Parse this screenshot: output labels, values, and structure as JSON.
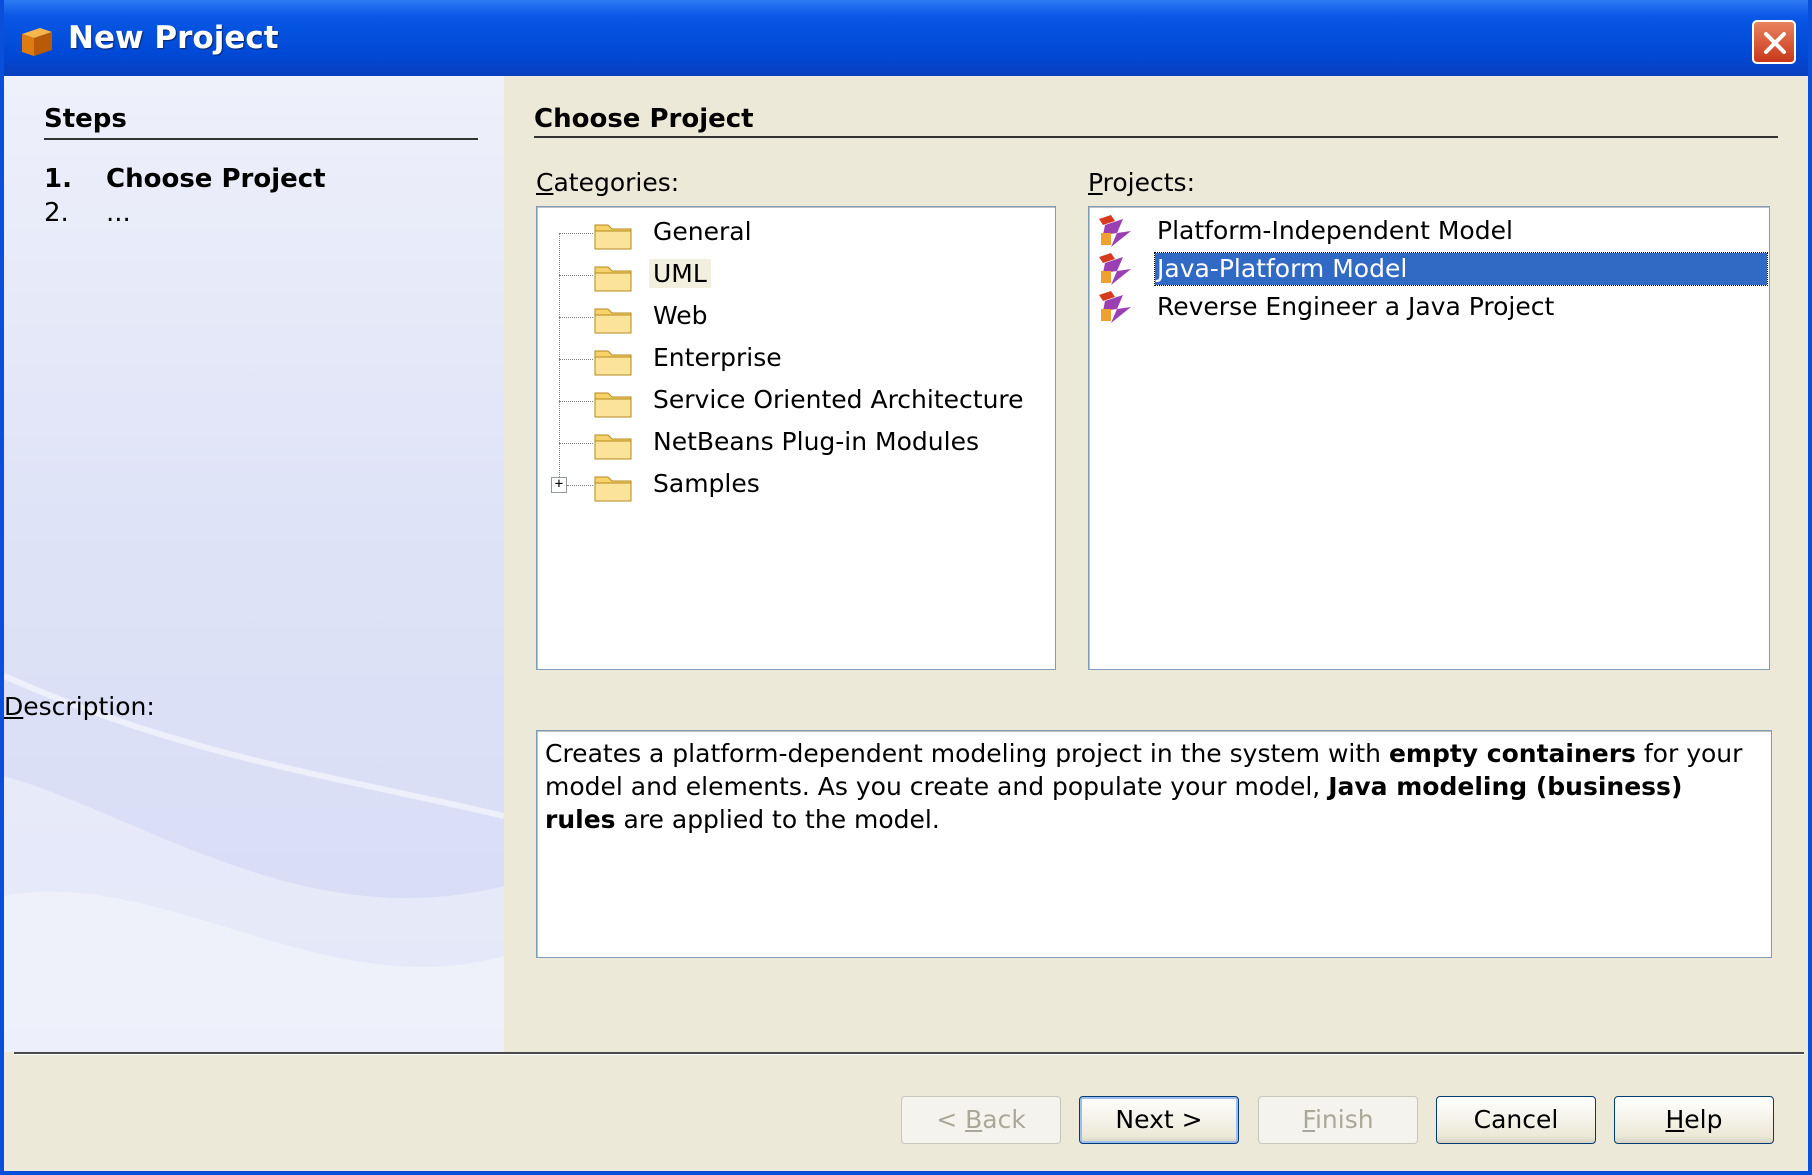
{
  "window": {
    "title": "New Project"
  },
  "steps": {
    "heading": "Steps",
    "items": [
      {
        "number": "1.",
        "label": "Choose Project",
        "current": true
      },
      {
        "number": "2.",
        "label": "...",
        "current": false
      }
    ]
  },
  "main": {
    "heading": "Choose Project",
    "categories": {
      "label_pre": "",
      "label_key": "C",
      "label_post": "ategories:",
      "items": [
        {
          "label": "General",
          "selected": false
        },
        {
          "label": "UML",
          "selected": true
        },
        {
          "label": "Web",
          "selected": false
        },
        {
          "label": "Enterprise",
          "selected": false
        },
        {
          "label": "Service Oriented Architecture",
          "selected": false
        },
        {
          "label": "NetBeans Plug-in Modules",
          "selected": false
        },
        {
          "label": "Samples",
          "selected": false,
          "expander": "+"
        }
      ]
    },
    "projects": {
      "label_pre": "",
      "label_key": "P",
      "label_post": "rojects:",
      "items": [
        {
          "label": "Platform-Independent Model",
          "selected": false
        },
        {
          "label": "Java-Platform Model",
          "selected": true
        },
        {
          "label": "Reverse Engineer a Java Project",
          "selected": false
        }
      ]
    },
    "description": {
      "label_key": "D",
      "label_post": "escription:",
      "part1": "Creates a platform-dependent modeling project in the system with ",
      "bold1": "empty containers",
      "part2": " for your model and elements. As you create and populate your model, ",
      "bold2": "Java modeling (business) rules",
      "part3": " are applied to the model."
    }
  },
  "buttons": {
    "back": {
      "pre": "< ",
      "key": "B",
      "post": "ack"
    },
    "next": {
      "label": "Next >"
    },
    "finish": {
      "key": "F",
      "post": "inish"
    },
    "cancel": {
      "label": "Cancel"
    },
    "help": {
      "key": "H",
      "post": "elp"
    }
  },
  "colors": {
    "titlebar": "#0049d6",
    "selection": "#316ac5",
    "close": "#c8371b"
  }
}
